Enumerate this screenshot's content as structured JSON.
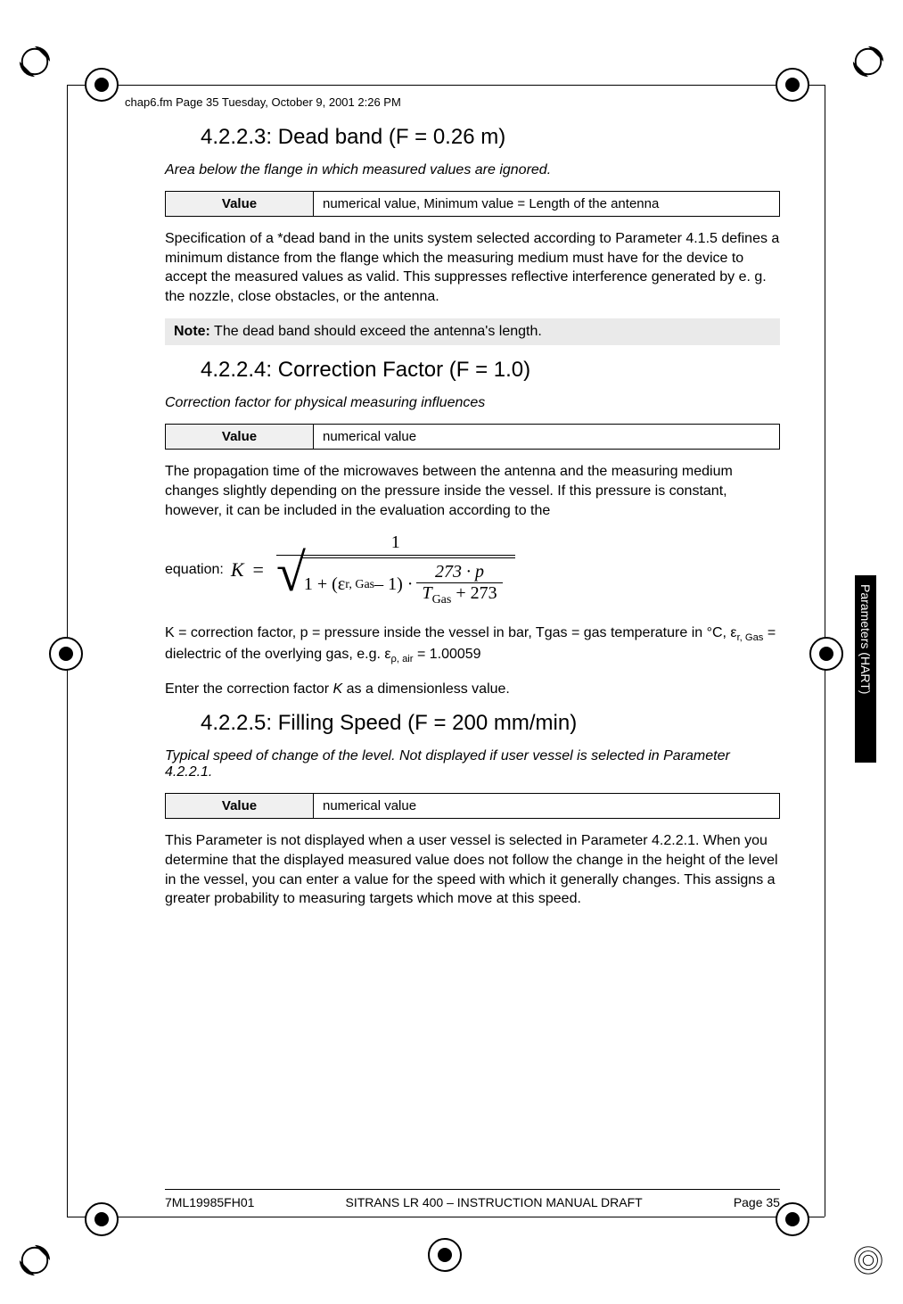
{
  "header_line": "chap6.fm  Page 35  Tuesday, October 9, 2001  2:26 PM",
  "section1": {
    "heading": "4.2.2.3: Dead band (F = 0.26 m)",
    "desc": "Area below the flange in which measured values are ignored.",
    "table_label": "Value",
    "table_value": "numerical value, Minimum value = Length of the antenna",
    "body": "Specification of a *dead band in the units system selected according to Parameter 4.1.5 defines a minimum distance from the flange which the measuring medium must have for the device to accept the measured values as valid. This suppresses reflective interference generated by e. g. the nozzle, close obstacles, or the antenna.",
    "note_label": "Note:",
    "note_text": " The dead band should exceed the antenna's length."
  },
  "section2": {
    "heading": "4.2.2.4: Correction Factor (F = 1.0)",
    "desc": "Correction factor for physical measuring influences",
    "table_label": "Value",
    "table_value": "numerical value",
    "body1": "The propagation time of the microwaves between the antenna and the measuring medium changes slightly depending on the pressure inside the vessel. If this pressure is constant, however, it can be included in the evaluation according to the",
    "equation_label": "equation:",
    "eq": {
      "K": "K",
      "eq_sign": "=",
      "numerator": "1",
      "one_plus": "1 + (ε",
      "sub1": "r, Gas",
      "minus1": " – 1) · ",
      "inner_num": "273 · p",
      "inner_den_T": "T",
      "inner_den_sub": "Gas",
      "inner_den_rest": " + 273"
    },
    "body2_a": "K = correction factor, p = pressure inside the vessel in bar, Tgas = gas temperature in °C, ε",
    "body2_sub1": "r, Gas",
    "body2_b": " = dielectric of the overlying gas, e.g. ε",
    "body2_sub2": "ρ, air",
    "body2_c": " = 1.00059",
    "body3_a": "Enter the correction factor ",
    "body3_i": "K",
    "body3_b": " as a dimensionless value."
  },
  "section3": {
    "heading": "4.2.2.5: Filling Speed (F = 200 mm/min)",
    "desc": "Typical speed of change of the level. Not displayed if user vessel is selected in Parameter 4.2.2.1.",
    "table_label": "Value",
    "table_value": "numerical value",
    "body": "This Parameter is not displayed when a user vessel is selected in Parameter 4.2.2.1. When you determine that the displayed measured value does not follow the change in the height of the level in the vessel, you can enter a value for the speed with which it generally changes. This assigns a greater probability to measuring targets which move at this speed."
  },
  "side_tab": "Parameters (HART)",
  "footer": {
    "left": "7ML19985FH01",
    "center": "SITRANS LR 400 – INSTRUCTION MANUAL DRAFT",
    "right": "Page 35"
  }
}
